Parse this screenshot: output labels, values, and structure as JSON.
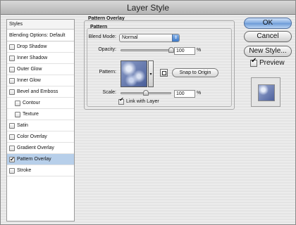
{
  "window": {
    "title": "Layer Style"
  },
  "styles_panel": {
    "header": "Styles",
    "blending_options": "Blending Options: Default",
    "items": [
      {
        "label": "Drop Shadow",
        "checked": false,
        "indent": false,
        "selected": false
      },
      {
        "label": "Inner Shadow",
        "checked": false,
        "indent": false,
        "selected": false
      },
      {
        "label": "Outer Glow",
        "checked": false,
        "indent": false,
        "selected": false
      },
      {
        "label": "Inner Glow",
        "checked": false,
        "indent": false,
        "selected": false
      },
      {
        "label": "Bevel and Emboss",
        "checked": false,
        "indent": false,
        "selected": false
      },
      {
        "label": "Contour",
        "checked": false,
        "indent": true,
        "selected": false
      },
      {
        "label": "Texture",
        "checked": false,
        "indent": true,
        "selected": false
      },
      {
        "label": "Satin",
        "checked": false,
        "indent": false,
        "selected": false
      },
      {
        "label": "Color Overlay",
        "checked": false,
        "indent": false,
        "selected": false
      },
      {
        "label": "Gradient Overlay",
        "checked": false,
        "indent": false,
        "selected": false
      },
      {
        "label": "Pattern Overlay",
        "checked": true,
        "indent": false,
        "selected": true
      },
      {
        "label": "Stroke",
        "checked": false,
        "indent": false,
        "selected": false
      }
    ]
  },
  "pattern_overlay": {
    "group_title": "Pattern Overlay",
    "subgroup_title": "Pattern",
    "blend_mode_label": "Blend Mode:",
    "blend_mode_value": "Normal",
    "opacity_label": "Opacity:",
    "opacity_value": "100",
    "opacity_unit": "%",
    "opacity_fraction": 1.0,
    "pattern_label": "Pattern:",
    "snap_button": "Snap to Origin",
    "scale_label": "Scale:",
    "scale_value": "100",
    "scale_unit": "%",
    "scale_fraction": 0.5,
    "link_label": "Link with Layer",
    "link_checked": true
  },
  "actions": {
    "ok": "OK",
    "cancel": "Cancel",
    "new_style": "New Style...",
    "preview_label": "Preview",
    "preview_checked": true
  },
  "colors": {
    "selected_row": "#b7cfea",
    "accent": "#6c9ad6"
  }
}
